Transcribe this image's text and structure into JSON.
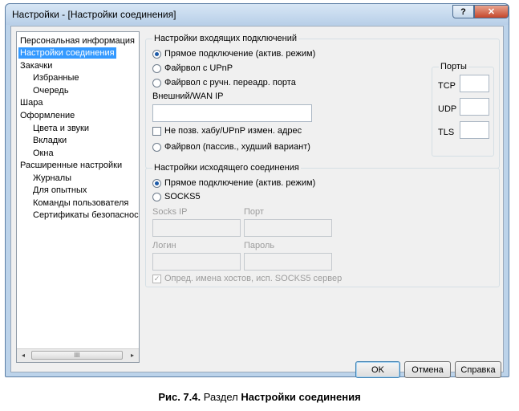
{
  "window": {
    "title": "Настройки - [Настройки соединения]",
    "help": "?",
    "close": "✕"
  },
  "tree": {
    "items": [
      {
        "label": "Персональная информация"
      },
      {
        "label": "Настройки соединения"
      },
      {
        "label": "Закачки"
      },
      {
        "label": "Избранные"
      },
      {
        "label": "Очередь"
      },
      {
        "label": "Шара"
      },
      {
        "label": "Оформление"
      },
      {
        "label": "Цвета и звуки"
      },
      {
        "label": "Вкладки"
      },
      {
        "label": "Окна"
      },
      {
        "label": "Расширенные настройки"
      },
      {
        "label": "Журналы"
      },
      {
        "label": "Для опытных"
      },
      {
        "label": "Команды пользователя"
      },
      {
        "label": "Сертификаты безопаснос"
      }
    ],
    "selected": "Настройки соединения",
    "scroll_left": "◂",
    "scroll_right": "▸",
    "scroll_grip": "III"
  },
  "incoming": {
    "title": "Настройки входящих подключений",
    "opt1": "Прямое подключение (актив. режим)",
    "opt2": "Файрвол с UPnP",
    "opt3": "Файрвол с ручн. переадр. порта",
    "wan_label": "Внешний/WAN IP",
    "wan_value": "",
    "nochange": "Не позв. хабу/UPnP измен. адрес",
    "opt4": "Файрвол (пассив., худший вариант)",
    "selected": "Прямое подключение (актив. режим)",
    "ports": {
      "title": "Порты",
      "tcp": "TCP",
      "udp": "UDP",
      "tls": "TLS",
      "tcp_value": "",
      "udp_value": "",
      "tls_value": ""
    }
  },
  "outgoing": {
    "title": "Настройки исходящего соединения",
    "opt1": "Прямое подключение (актив. режим)",
    "opt2": "SOCKS5",
    "selected": "Прямое подключение (актив. режим)",
    "socks_ip": "Socks IP",
    "port": "Порт",
    "login": "Логин",
    "password": "Пароль",
    "resolve": "Опред. имена хостов, исп. SOCKS5 сервер",
    "resolve_checked": true
  },
  "buttons": {
    "ok": "OK",
    "cancel": "Отмена",
    "help": "Справка"
  },
  "caption": {
    "prefix": "Рис. 7.4.",
    "text": " Раздел ",
    "bold": "Настройки соединения"
  }
}
